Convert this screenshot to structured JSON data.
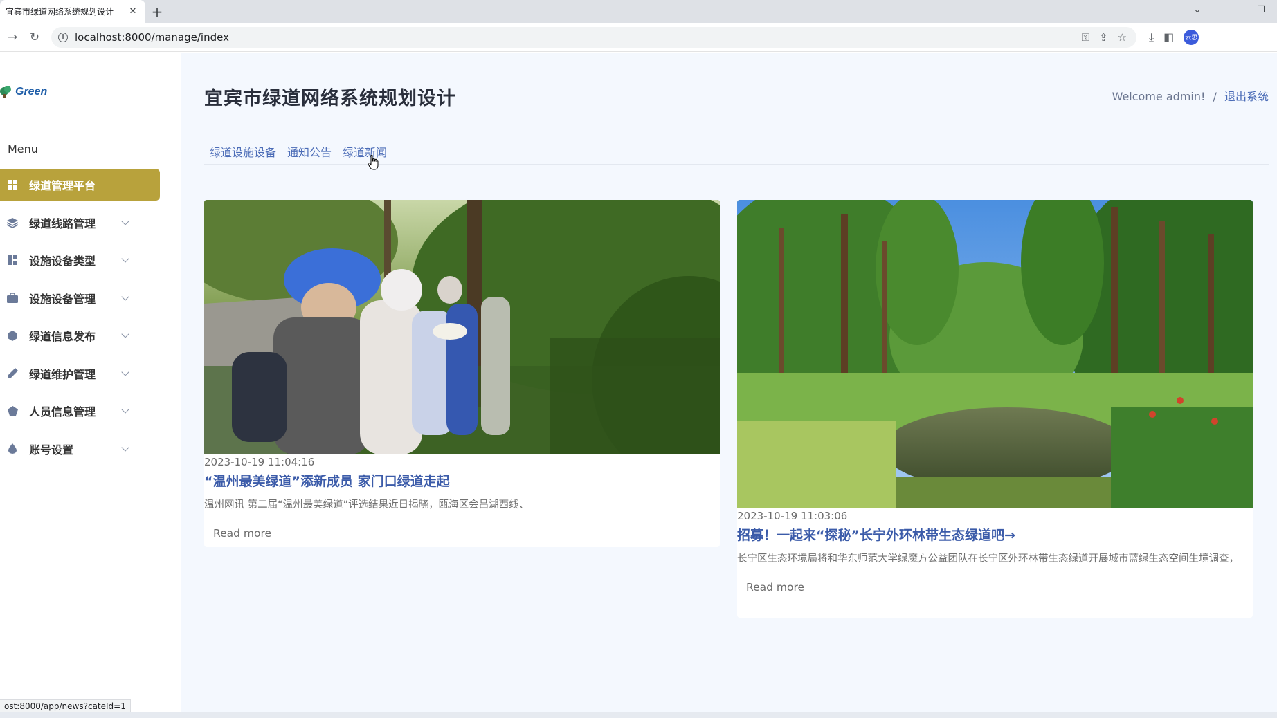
{
  "browser": {
    "tab_title": "宜宾市绿道网络系统规划设计",
    "tab_close": "✕",
    "new_tab": "+",
    "url": "localhost:8000/manage/index",
    "status_url": "ost:8000/app/news?cateId=1",
    "profile_initials": "云思"
  },
  "sidebar": {
    "logo_text": "Green",
    "menu_label": "Menu",
    "items": [
      {
        "label": "绿道管理平台",
        "icon": "grid-icon",
        "active": true
      },
      {
        "label": "绿道线路管理",
        "icon": "layers-icon"
      },
      {
        "label": "设施设备类型",
        "icon": "dashboard-icon"
      },
      {
        "label": "设施设备管理",
        "icon": "briefcase-icon"
      },
      {
        "label": "绿道信息发布",
        "icon": "hexagon-icon"
      },
      {
        "label": "绿道维护管理",
        "icon": "pen-icon"
      },
      {
        "label": "人员信息管理",
        "icon": "pentagon-icon"
      },
      {
        "label": "账号设置",
        "icon": "drop-icon"
      }
    ],
    "active_color": "#b8a23c"
  },
  "header": {
    "title": "宜宾市绿道网络系统规划设计",
    "welcome": "Welcome admin!",
    "separator": "/",
    "logout": "退出系统"
  },
  "categories": [
    "绿道设施设备",
    "通知公告",
    "绿道新闻"
  ],
  "news": [
    {
      "date": "2023-10-19 11:04:16",
      "title": "“温州最美绿道”添新成员 家门口绿道走起",
      "excerpt": "温州网讯 第二届“温州最美绿道”评选结果近日揭晓，瓯海区会昌湖西线、",
      "read_more": "Read more"
    },
    {
      "date": "2023-10-19 11:03:06",
      "title": "招募！一起来“探秘”长宁外环林带生态绿道吧→",
      "excerpt": "长宁区生态环境局将和华东师范大学绿魔方公益团队在长宁区外环林带生态绿道开展城市蓝绿生态空间生境调查，",
      "read_more": "Read more"
    }
  ]
}
